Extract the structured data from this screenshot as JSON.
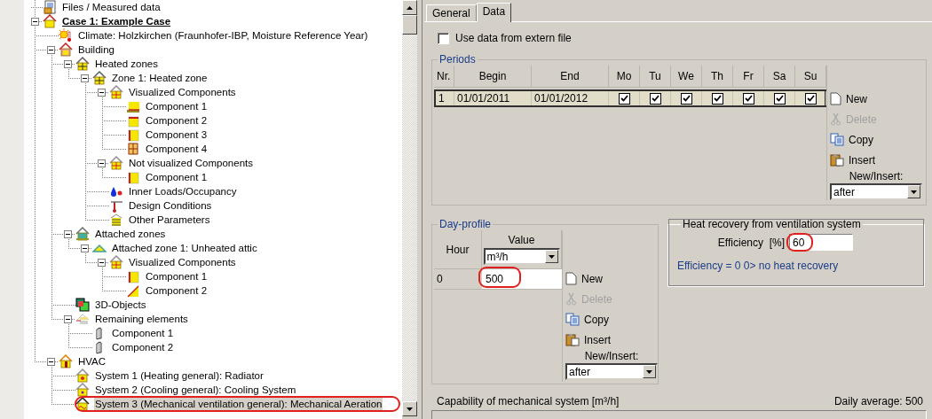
{
  "tree": {
    "items": [
      {
        "label": "Files / Measured data",
        "kind": "files",
        "selected": false
      },
      {
        "label": "Case 1: Example Case",
        "kind": "case",
        "selected": false,
        "expanded": true,
        "children": [
          {
            "label": "Climate: Holzkirchen (Fraunhofer-IBP, Moisture Reference Year)",
            "kind": "climate",
            "selected": false
          },
          {
            "label": "Building",
            "kind": "building",
            "selected": false,
            "expanded": true,
            "children": [
              {
                "label": "Heated zones",
                "kind": "zones",
                "selected": false,
                "expanded": true,
                "children": [
                  {
                    "label": "Zone 1: Heated zone",
                    "kind": "zone",
                    "selected": false,
                    "expanded": true,
                    "children": [
                      {
                        "label": "Visualized Components",
                        "kind": "components",
                        "selected": false,
                        "expanded": true,
                        "children": [
                          {
                            "label": "Component 1",
                            "kind": "floor",
                            "selected": false
                          },
                          {
                            "label": "Component 2",
                            "kind": "roof",
                            "selected": false
                          },
                          {
                            "label": "Component 3",
                            "kind": "wall",
                            "selected": false
                          },
                          {
                            "label": "Component 4",
                            "kind": "window",
                            "selected": false
                          }
                        ]
                      },
                      {
                        "label": "Not visualized Components",
                        "kind": "components",
                        "selected": false,
                        "expanded": true,
                        "children": [
                          {
                            "label": "Component 1",
                            "kind": "wall",
                            "selected": false
                          }
                        ]
                      },
                      {
                        "label": "Inner Loads/Occupancy",
                        "kind": "loads",
                        "selected": false
                      },
                      {
                        "label": "Design Conditions",
                        "kind": "conditions",
                        "selected": false
                      },
                      {
                        "label": "Other Parameters",
                        "kind": "parameters",
                        "selected": false
                      }
                    ]
                  }
                ]
              },
              {
                "label": "Attached zones",
                "kind": "attached",
                "selected": false,
                "expanded": true,
                "children": [
                  {
                    "label": "Attached zone 1: Unheated attic",
                    "kind": "attic",
                    "selected": false,
                    "expanded": true,
                    "children": [
                      {
                        "label": "Visualized Components",
                        "kind": "components",
                        "selected": false,
                        "expanded": true,
                        "children": [
                          {
                            "label": "Component 1",
                            "kind": "wall",
                            "selected": false
                          },
                          {
                            "label": "Component 2",
                            "kind": "slope",
                            "selected": false
                          }
                        ]
                      }
                    ]
                  }
                ]
              },
              {
                "label": "3D-Objects",
                "kind": "objects",
                "selected": false
              },
              {
                "label": "Remaining elements",
                "kind": "remaining",
                "selected": false,
                "expanded": true,
                "children": [
                  {
                    "label": "Component 1",
                    "kind": "panel",
                    "selected": false
                  },
                  {
                    "label": "Component 2",
                    "kind": "panel",
                    "selected": false
                  }
                ]
              }
            ]
          },
          {
            "label": "HVAC",
            "kind": "hvac",
            "selected": false,
            "expanded": true,
            "children": [
              {
                "label": "System 1 (Heating general): Radiator",
                "kind": "heating",
                "selected": false
              },
              {
                "label": "System 2 (Cooling general): Cooling System",
                "kind": "cooling",
                "selected": false
              },
              {
                "label": "System 3 (Mechanical ventilation general): Mechanical Aeration",
                "kind": "ventilation",
                "selected": true,
                "circled": true
              }
            ]
          }
        ]
      }
    ]
  },
  "tabs": [
    {
      "label": "General",
      "selected": false
    },
    {
      "label": "Data",
      "selected": true
    }
  ],
  "extern_file": {
    "label": "Use data from extern file",
    "checked": false
  },
  "periods": {
    "title": "Periods",
    "columns": [
      "Nr.",
      "Begin",
      "End",
      "Mo",
      "Tu",
      "We",
      "Th",
      "Fr",
      "Sa",
      "Su"
    ],
    "rows": [
      {
        "nr": "1",
        "begin": "01/01/2011",
        "end": "01/01/2012",
        "selected": true,
        "days": [
          {
            "checked": true
          },
          {
            "checked": true
          },
          {
            "checked": true
          },
          {
            "checked": true
          },
          {
            "checked": true
          },
          {
            "checked": true
          },
          {
            "checked": true
          }
        ]
      }
    ],
    "buttons": [
      {
        "label": "New",
        "kind": "new",
        "disabled": false
      },
      {
        "label": "Delete",
        "kind": "delete",
        "disabled": true
      },
      {
        "label": "Copy",
        "kind": "copy",
        "disabled": false
      },
      {
        "label": "Insert",
        "kind": "insert",
        "disabled": false
      }
    ],
    "insert_label": "New/Insert:",
    "insert_position": "after"
  },
  "day_profile": {
    "title": "Day-profile",
    "hour_header": "Hour",
    "value_header": "Value",
    "unit": "m³/h",
    "rows": [
      {
        "hour": "0",
        "value": "500",
        "circled": true
      }
    ],
    "buttons": [
      {
        "label": "New",
        "kind": "new",
        "disabled": false
      },
      {
        "label": "Delete",
        "kind": "delete",
        "disabled": true
      },
      {
        "label": "Copy",
        "kind": "copy",
        "disabled": false
      },
      {
        "label": "Insert",
        "kind": "insert",
        "disabled": false
      }
    ],
    "insert_label": "New/Insert:",
    "insert_position": "after"
  },
  "heat_recovery": {
    "title": "Heat recovery from ventilation system",
    "label": "Efficiency  [%]",
    "value": "60",
    "circled": true,
    "note": "Efficiency = 0 0> no heat recovery"
  },
  "capability": {
    "label": "Capability of mechanical system [m³/h]",
    "daily_average": "Daily average: 500"
  }
}
